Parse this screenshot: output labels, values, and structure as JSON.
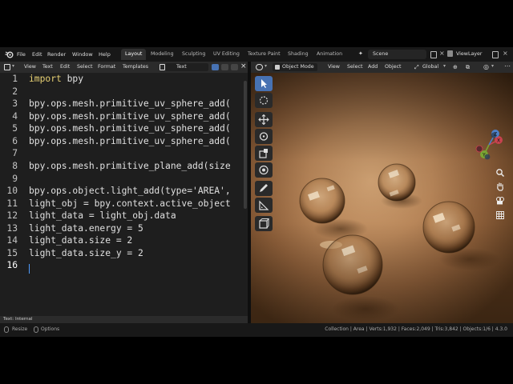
{
  "topbar": {
    "menus": [
      "File",
      "Edit",
      "Render",
      "Window",
      "Help"
    ],
    "workspaces": [
      "Layout",
      "Modeling",
      "Sculpting",
      "UV Editing",
      "Texture Paint",
      "Shading",
      "Animation"
    ],
    "active_workspace": "Layout",
    "scene": "Scene",
    "view_layer": "ViewLayer"
  },
  "text_editor": {
    "header_menus": [
      "View",
      "Text",
      "Edit",
      "Select",
      "Format",
      "Templates"
    ],
    "text_name": "Text",
    "line_numbers": [
      "1",
      "2",
      "3",
      "4",
      "5",
      "6",
      "7",
      "8",
      "9",
      "10",
      "11",
      "12",
      "13",
      "14",
      "15",
      "16"
    ],
    "lines": [
      {
        "kw": "import",
        "rest": " bpy"
      },
      {
        "kw": "",
        "rest": ""
      },
      {
        "kw": "",
        "rest": "bpy.ops.mesh.primitive_uv_sphere_add("
      },
      {
        "kw": "",
        "rest": "bpy.ops.mesh.primitive_uv_sphere_add("
      },
      {
        "kw": "",
        "rest": "bpy.ops.mesh.primitive_uv_sphere_add("
      },
      {
        "kw": "",
        "rest": "bpy.ops.mesh.primitive_uv_sphere_add("
      },
      {
        "kw": "",
        "rest": ""
      },
      {
        "kw": "",
        "rest": "bpy.ops.mesh.primitive_plane_add(size"
      },
      {
        "kw": "",
        "rest": ""
      },
      {
        "kw": "",
        "rest": "bpy.ops.object.light_add(type='AREA',"
      },
      {
        "kw": "",
        "rest": "light_obj = bpy.context.active_object"
      },
      {
        "kw": "",
        "rest": "light_data = light_obj.data"
      },
      {
        "kw": "",
        "rest": "light_data.energy = 5"
      },
      {
        "kw": "",
        "rest": "light_data.size = 2"
      },
      {
        "kw": "",
        "rest": "light_data.size_y = 2"
      },
      {
        "kw": "",
        "rest": ""
      }
    ],
    "footer": "Text: Internal"
  },
  "viewport": {
    "mode": "Object Mode",
    "header_menus": [
      "View",
      "Select",
      "Add",
      "Object"
    ],
    "transform_orientation": "Global",
    "gizmo_axes": [
      "X",
      "Y",
      "Z"
    ]
  },
  "statusbar": {
    "left": [
      "Resize",
      "Options"
    ],
    "stats": "Collection | Area | Verts:1,932 | Faces:2,049 | Tris:3,842 | Objects:1/6 | 4.3.0"
  },
  "colors": {
    "accent": "#4772b3",
    "keyword": "#e8d174",
    "floor_light": "#d2a475",
    "floor_dark": "#4f3219"
  }
}
